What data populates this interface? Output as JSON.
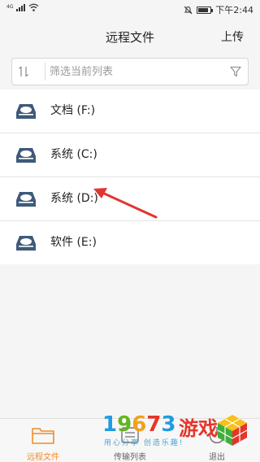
{
  "status_bar": {
    "network": "4G",
    "time": "下午2:44",
    "icons": [
      "signal-icon",
      "wifi-icon",
      "mute-icon",
      "battery-icon"
    ]
  },
  "header": {
    "title": "远程文件",
    "upload_label": "上传"
  },
  "filter": {
    "placeholder": "筛选当前列表",
    "value": "",
    "icons": [
      "sort-icon",
      "filter-funnel-icon"
    ]
  },
  "drives": [
    {
      "label": "文档 (F:)",
      "icon": "drive-icon"
    },
    {
      "label": "系统 (C:)",
      "icon": "drive-icon"
    },
    {
      "label": "系统 (D:)",
      "icon": "drive-icon"
    },
    {
      "label": "软件 (E:)",
      "icon": "drive-icon"
    }
  ],
  "annotation": {
    "type": "arrow",
    "color": "#e3342f",
    "points_to": "系统 (D:)"
  },
  "bottom_nav": {
    "tabs": [
      {
        "label": "远程文件",
        "icon": "folder-icon",
        "active": true
      },
      {
        "label": "传输列表",
        "icon": "transfer-list-icon",
        "active": false
      },
      {
        "label": "退出",
        "icon": "power-icon",
        "active": false
      }
    ],
    "accent_color": "#f08c2a"
  },
  "watermark": {
    "number": "19673",
    "chinese": "游戏",
    "slogan": "用心分享 创造乐趣!"
  },
  "colors": {
    "background": "#f5f5f5",
    "drive_icon": "#3f5a7a",
    "active_tab": "#f08c2a",
    "arrow": "#e3342f"
  }
}
